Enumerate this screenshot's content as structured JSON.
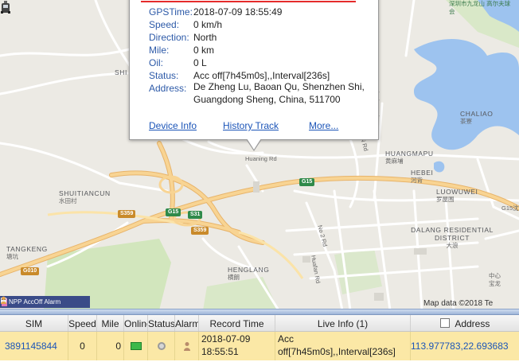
{
  "map": {
    "labels": {
      "shuitiancun": "SHUITIANCUN",
      "shuitiancun_cn": "水田村",
      "tangkeng": "TANGKENG",
      "tangkeng_cn": "塘坑",
      "henglang": "HENGLANG",
      "henglang_cn": "横朗",
      "huangmapu": "HUANGMAPU",
      "huangmapu_cn": "黄麻埔",
      "hebei": "HEBEI",
      "hebei_cn": "河背",
      "luowuwei": "LUOWUWEI",
      "luowuwei_cn": "罗屋围",
      "dalang": "DALANG RESIDENTIAL DISTRICT",
      "dalang_cn": "大浪",
      "chaliao": "CHALIAO",
      "chaliao_cn": "茶寮",
      "top_right_cn": "深圳市九龙山 高尔夫球会",
      "shi": "SHI",
      "hexing_rd": "Huaning Rd",
      "no2_rd": "No 2 Rd",
      "huafan_rd": "Huafan Rd",
      "xinqiao_rd": "Xinqiao Rd",
      "n_rd": "N Rd",
      "g15": "G15",
      "s359": "S359",
      "s31": "S31",
      "g010": "G010",
      "g15x": "G15沈",
      "zhongxin": "中心",
      "baolong": "宝龙",
      "baobei": "宝北"
    },
    "attribution": "Map data ©2018 Te"
  },
  "popup": {
    "rows": [
      {
        "label": "GPSTime:",
        "value": "2018-07-09 18:55:49"
      },
      {
        "label": "Speed:",
        "value": "0 km/h"
      },
      {
        "label": "Direction:",
        "value": "North"
      },
      {
        "label": "Mile:",
        "value": "0 km"
      },
      {
        "label": "Oil:",
        "value": "0 L"
      },
      {
        "label": "Status:",
        "value": "Acc off[7h45m0s],,Interval[236s]"
      }
    ],
    "address_label": "Address:",
    "address_value": "De Zheng Lu, Baoan Qu, Shenzhen Shi, Guangdong Sheng, China, 511700",
    "links": {
      "device_info": "Device Info",
      "history_track": "History Track",
      "more": "More..."
    }
  },
  "legend": {
    "npp": "NPP",
    "accoff": "AccOff",
    "alarm": "Alarm"
  },
  "grid": {
    "headers": {
      "sim": "SIM",
      "speed": "Speed",
      "mile": "Mile",
      "online": "Online",
      "status": "Status",
      "alarm": "Alarm",
      "record_time": "Record Time",
      "live_info": "Live Info (1)",
      "address": "Address"
    },
    "row": {
      "sim": "3891145844",
      "speed": "0",
      "mile": "0",
      "record_time": "2018-07-09 18:55:51",
      "live_info": "Acc off[7h45m0s],,Interval[236s]",
      "address": "113.977783,22.693683"
    }
  },
  "colors": {
    "water": "#9dc3ef",
    "highway": "#f6c77a",
    "park": "#d2e6bd",
    "grid_row": "#fbe8a6",
    "popup_rule": "#e52b2b"
  }
}
